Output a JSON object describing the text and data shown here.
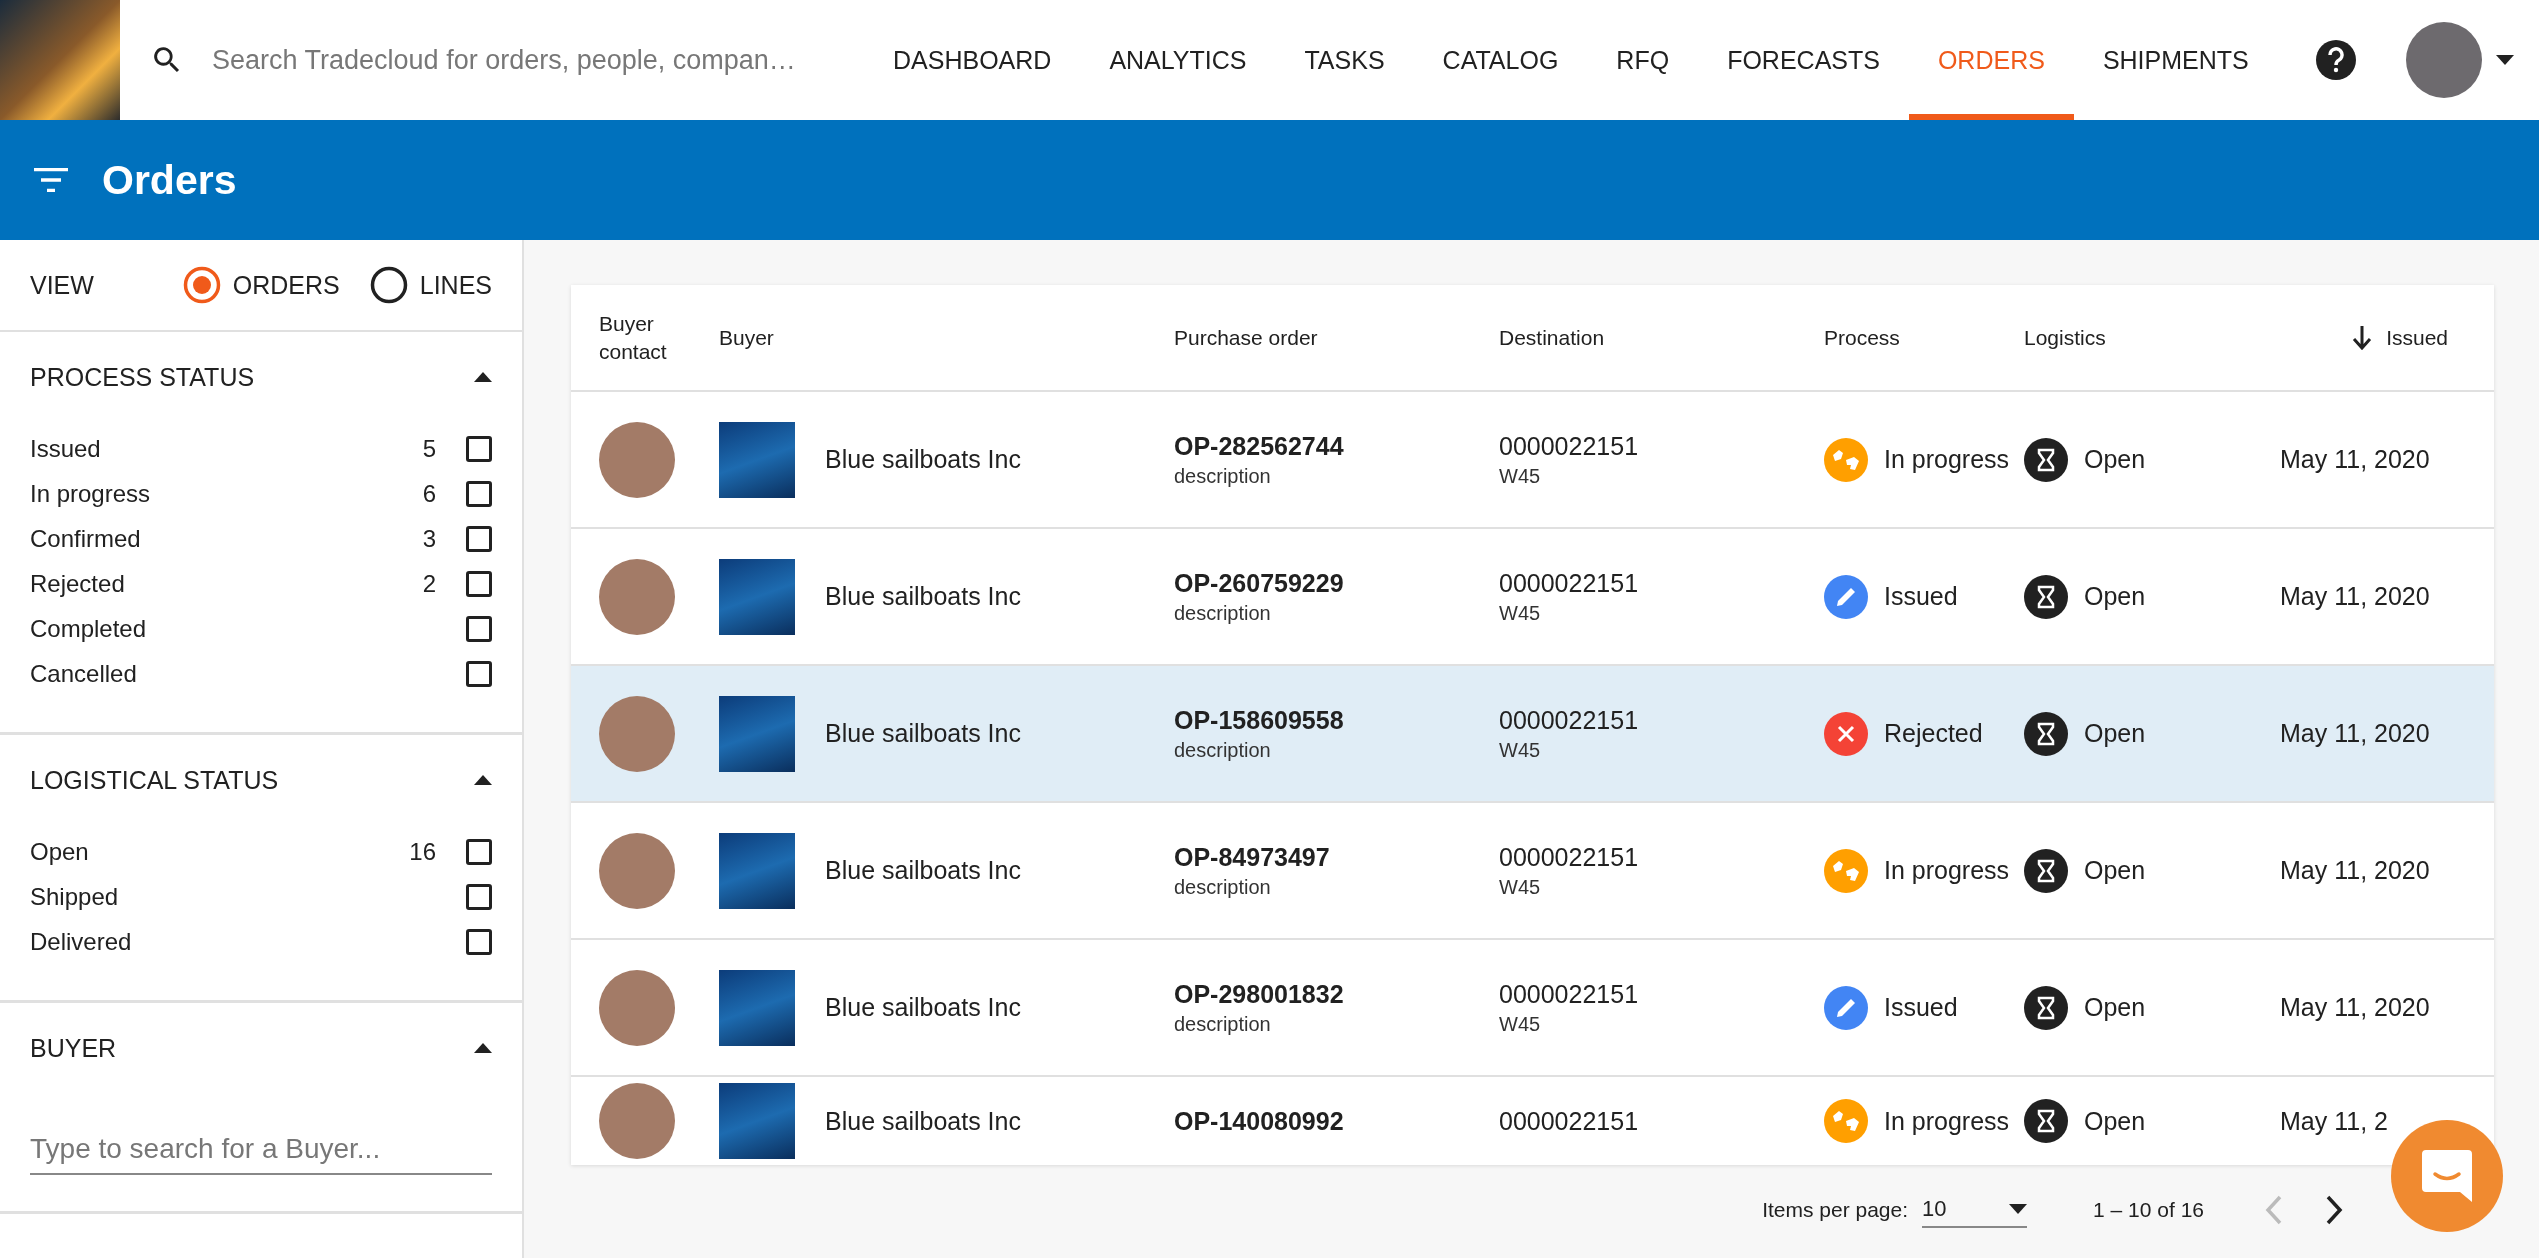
{
  "top_bar": {
    "search": {
      "placeholder": "Search Tradecloud for orders, people, compan…"
    },
    "nav": [
      {
        "label": "DASHBOARD",
        "selected": false
      },
      {
        "label": "ANALYTICS",
        "selected": false
      },
      {
        "label": "TASKS",
        "selected": false
      },
      {
        "label": "CATALOG",
        "selected": false
      },
      {
        "label": "RFQ",
        "selected": false
      },
      {
        "label": "FORECASTS",
        "selected": false
      },
      {
        "label": "ORDERS",
        "selected": true
      },
      {
        "label": "SHIPMENTS",
        "selected": false
      }
    ]
  },
  "header": {
    "title": "Orders"
  },
  "sidebar": {
    "view": {
      "label": "VIEW",
      "options": [
        {
          "label": "ORDERS",
          "selected": true
        },
        {
          "label": "LINES",
          "selected": false
        }
      ]
    },
    "groups": [
      {
        "kind": "checklist",
        "title": "PROCESS STATUS",
        "expanded": true,
        "items": [
          {
            "label": "Issued",
            "count": "5",
            "checked": false
          },
          {
            "label": "In progress",
            "count": "6",
            "checked": false
          },
          {
            "label": "Confirmed",
            "count": "3",
            "checked": false
          },
          {
            "label": "Rejected",
            "count": "2",
            "checked": false
          },
          {
            "label": "Completed",
            "checked": false
          },
          {
            "label": "Cancelled",
            "checked": false
          }
        ]
      },
      {
        "kind": "checklist",
        "title": "LOGISTICAL STATUS",
        "expanded": true,
        "items": [
          {
            "label": "Open",
            "count": "16",
            "checked": false
          },
          {
            "label": "Shipped",
            "checked": false
          },
          {
            "label": "Delivered",
            "checked": false
          }
        ]
      },
      {
        "kind": "search",
        "title": "BUYER",
        "expanded": true,
        "placeholder": "Type to search for a Buyer..."
      }
    ]
  },
  "table": {
    "columns": [
      {
        "label": "Buyer contact",
        "sorted": false
      },
      {
        "label": "Buyer",
        "sorted": false
      },
      {
        "label": "Purchase order",
        "sorted": false
      },
      {
        "label": "Destination",
        "sorted": false
      },
      {
        "label": "Process",
        "sorted": false
      },
      {
        "label": "Logistics",
        "sorted": false
      },
      {
        "label": "Issued",
        "sorted": true
      }
    ],
    "rows": [
      {
        "selected": false,
        "buyer": "Blue sailboats Inc",
        "po": "OP-282562744",
        "description": "description",
        "destination": "0000022151",
        "week": "W45",
        "process": {
          "kind": "in_progress",
          "label": "In progress"
        },
        "logistics": {
          "kind": "open",
          "label": "Open"
        },
        "issued": "May 11, 2020"
      },
      {
        "selected": false,
        "buyer": "Blue sailboats Inc",
        "po": "OP-260759229",
        "description": "description",
        "destination": "0000022151",
        "week": "W45",
        "process": {
          "kind": "issued",
          "label": "Issued"
        },
        "logistics": {
          "kind": "open",
          "label": "Open"
        },
        "issued": "May 11, 2020"
      },
      {
        "selected": true,
        "buyer": "Blue sailboats Inc",
        "po": "OP-158609558",
        "description": "description",
        "destination": "0000022151",
        "week": "W45",
        "process": {
          "kind": "rejected",
          "label": "Rejected"
        },
        "logistics": {
          "kind": "open",
          "label": "Open"
        },
        "issued": "May 11, 2020"
      },
      {
        "selected": false,
        "buyer": "Blue sailboats Inc",
        "po": "OP-84973497",
        "description": "description",
        "destination": "0000022151",
        "week": "W45",
        "process": {
          "kind": "in_progress",
          "label": "In progress"
        },
        "logistics": {
          "kind": "open",
          "label": "Open"
        },
        "issued": "May 11, 2020"
      },
      {
        "selected": false,
        "buyer": "Blue sailboats Inc",
        "po": "OP-298001832",
        "description": "description",
        "destination": "0000022151",
        "week": "W45",
        "process": {
          "kind": "issued",
          "label": "Issued"
        },
        "logistics": {
          "kind": "open",
          "label": "Open"
        },
        "issued": "May 11, 2020"
      },
      {
        "selected": false,
        "buyer": "Blue sailboats Inc",
        "po": "OP-140080992",
        "destination": "0000022151",
        "process": {
          "kind": "in_progress",
          "label": "In progress"
        },
        "logistics": {
          "kind": "open",
          "label": "Open"
        },
        "issued": "May 11, 2"
      }
    ]
  },
  "pagination": {
    "label": "Items per page:",
    "page_size": "10",
    "range": "1 – 10 of 16",
    "prev_disabled": true,
    "next_disabled": false
  }
}
